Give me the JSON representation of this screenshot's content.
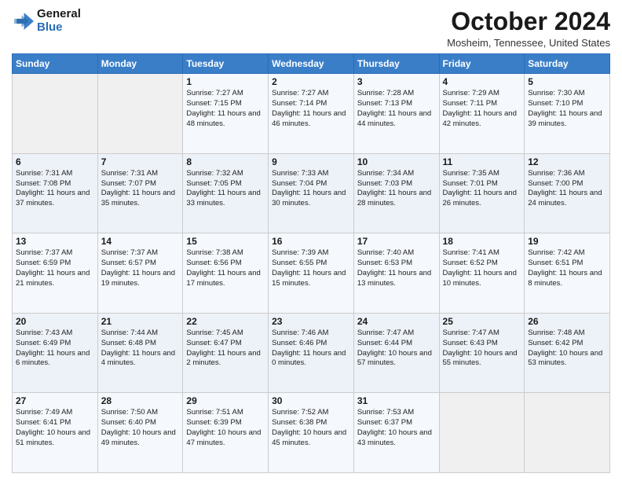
{
  "logo": {
    "line1": "General",
    "line2": "Blue"
  },
  "title": "October 2024",
  "location": "Mosheim, Tennessee, United States",
  "headers": [
    "Sunday",
    "Monday",
    "Tuesday",
    "Wednesday",
    "Thursday",
    "Friday",
    "Saturday"
  ],
  "weeks": [
    [
      {
        "day": "",
        "sunrise": "",
        "sunset": "",
        "daylight": ""
      },
      {
        "day": "",
        "sunrise": "",
        "sunset": "",
        "daylight": ""
      },
      {
        "day": "1",
        "sunrise": "Sunrise: 7:27 AM",
        "sunset": "Sunset: 7:15 PM",
        "daylight": "Daylight: 11 hours and 48 minutes."
      },
      {
        "day": "2",
        "sunrise": "Sunrise: 7:27 AM",
        "sunset": "Sunset: 7:14 PM",
        "daylight": "Daylight: 11 hours and 46 minutes."
      },
      {
        "day": "3",
        "sunrise": "Sunrise: 7:28 AM",
        "sunset": "Sunset: 7:13 PM",
        "daylight": "Daylight: 11 hours and 44 minutes."
      },
      {
        "day": "4",
        "sunrise": "Sunrise: 7:29 AM",
        "sunset": "Sunset: 7:11 PM",
        "daylight": "Daylight: 11 hours and 42 minutes."
      },
      {
        "day": "5",
        "sunrise": "Sunrise: 7:30 AM",
        "sunset": "Sunset: 7:10 PM",
        "daylight": "Daylight: 11 hours and 39 minutes."
      }
    ],
    [
      {
        "day": "6",
        "sunrise": "Sunrise: 7:31 AM",
        "sunset": "Sunset: 7:08 PM",
        "daylight": "Daylight: 11 hours and 37 minutes."
      },
      {
        "day": "7",
        "sunrise": "Sunrise: 7:31 AM",
        "sunset": "Sunset: 7:07 PM",
        "daylight": "Daylight: 11 hours and 35 minutes."
      },
      {
        "day": "8",
        "sunrise": "Sunrise: 7:32 AM",
        "sunset": "Sunset: 7:05 PM",
        "daylight": "Daylight: 11 hours and 33 minutes."
      },
      {
        "day": "9",
        "sunrise": "Sunrise: 7:33 AM",
        "sunset": "Sunset: 7:04 PM",
        "daylight": "Daylight: 11 hours and 30 minutes."
      },
      {
        "day": "10",
        "sunrise": "Sunrise: 7:34 AM",
        "sunset": "Sunset: 7:03 PM",
        "daylight": "Daylight: 11 hours and 28 minutes."
      },
      {
        "day": "11",
        "sunrise": "Sunrise: 7:35 AM",
        "sunset": "Sunset: 7:01 PM",
        "daylight": "Daylight: 11 hours and 26 minutes."
      },
      {
        "day": "12",
        "sunrise": "Sunrise: 7:36 AM",
        "sunset": "Sunset: 7:00 PM",
        "daylight": "Daylight: 11 hours and 24 minutes."
      }
    ],
    [
      {
        "day": "13",
        "sunrise": "Sunrise: 7:37 AM",
        "sunset": "Sunset: 6:59 PM",
        "daylight": "Daylight: 11 hours and 21 minutes."
      },
      {
        "day": "14",
        "sunrise": "Sunrise: 7:37 AM",
        "sunset": "Sunset: 6:57 PM",
        "daylight": "Daylight: 11 hours and 19 minutes."
      },
      {
        "day": "15",
        "sunrise": "Sunrise: 7:38 AM",
        "sunset": "Sunset: 6:56 PM",
        "daylight": "Daylight: 11 hours and 17 minutes."
      },
      {
        "day": "16",
        "sunrise": "Sunrise: 7:39 AM",
        "sunset": "Sunset: 6:55 PM",
        "daylight": "Daylight: 11 hours and 15 minutes."
      },
      {
        "day": "17",
        "sunrise": "Sunrise: 7:40 AM",
        "sunset": "Sunset: 6:53 PM",
        "daylight": "Daylight: 11 hours and 13 minutes."
      },
      {
        "day": "18",
        "sunrise": "Sunrise: 7:41 AM",
        "sunset": "Sunset: 6:52 PM",
        "daylight": "Daylight: 11 hours and 10 minutes."
      },
      {
        "day": "19",
        "sunrise": "Sunrise: 7:42 AM",
        "sunset": "Sunset: 6:51 PM",
        "daylight": "Daylight: 11 hours and 8 minutes."
      }
    ],
    [
      {
        "day": "20",
        "sunrise": "Sunrise: 7:43 AM",
        "sunset": "Sunset: 6:49 PM",
        "daylight": "Daylight: 11 hours and 6 minutes."
      },
      {
        "day": "21",
        "sunrise": "Sunrise: 7:44 AM",
        "sunset": "Sunset: 6:48 PM",
        "daylight": "Daylight: 11 hours and 4 minutes."
      },
      {
        "day": "22",
        "sunrise": "Sunrise: 7:45 AM",
        "sunset": "Sunset: 6:47 PM",
        "daylight": "Daylight: 11 hours and 2 minutes."
      },
      {
        "day": "23",
        "sunrise": "Sunrise: 7:46 AM",
        "sunset": "Sunset: 6:46 PM",
        "daylight": "Daylight: 11 hours and 0 minutes."
      },
      {
        "day": "24",
        "sunrise": "Sunrise: 7:47 AM",
        "sunset": "Sunset: 6:44 PM",
        "daylight": "Daylight: 10 hours and 57 minutes."
      },
      {
        "day": "25",
        "sunrise": "Sunrise: 7:47 AM",
        "sunset": "Sunset: 6:43 PM",
        "daylight": "Daylight: 10 hours and 55 minutes."
      },
      {
        "day": "26",
        "sunrise": "Sunrise: 7:48 AM",
        "sunset": "Sunset: 6:42 PM",
        "daylight": "Daylight: 10 hours and 53 minutes."
      }
    ],
    [
      {
        "day": "27",
        "sunrise": "Sunrise: 7:49 AM",
        "sunset": "Sunset: 6:41 PM",
        "daylight": "Daylight: 10 hours and 51 minutes."
      },
      {
        "day": "28",
        "sunrise": "Sunrise: 7:50 AM",
        "sunset": "Sunset: 6:40 PM",
        "daylight": "Daylight: 10 hours and 49 minutes."
      },
      {
        "day": "29",
        "sunrise": "Sunrise: 7:51 AM",
        "sunset": "Sunset: 6:39 PM",
        "daylight": "Daylight: 10 hours and 47 minutes."
      },
      {
        "day": "30",
        "sunrise": "Sunrise: 7:52 AM",
        "sunset": "Sunset: 6:38 PM",
        "daylight": "Daylight: 10 hours and 45 minutes."
      },
      {
        "day": "31",
        "sunrise": "Sunrise: 7:53 AM",
        "sunset": "Sunset: 6:37 PM",
        "daylight": "Daylight: 10 hours and 43 minutes."
      },
      {
        "day": "",
        "sunrise": "",
        "sunset": "",
        "daylight": ""
      },
      {
        "day": "",
        "sunrise": "",
        "sunset": "",
        "daylight": ""
      }
    ]
  ]
}
